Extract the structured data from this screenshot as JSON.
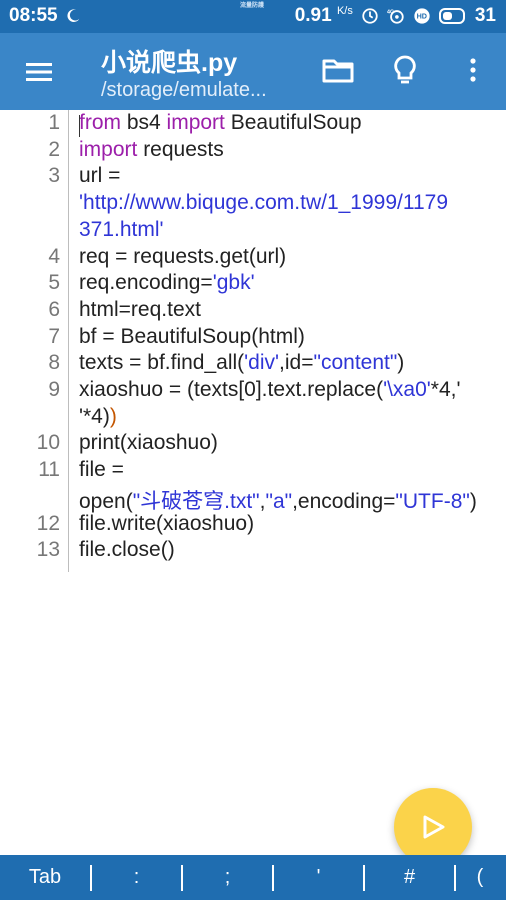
{
  "status_bar": {
    "time": "08:55",
    "center_text": "流量防護",
    "net_speed": "0.91",
    "net_unit": "K/s",
    "battery": "31"
  },
  "app_bar": {
    "title": "小说爬虫.py",
    "subtitle": "/storage/emulate...",
    "icons": [
      "menu-icon",
      "folder-icon",
      "lightbulb-icon",
      "more-vertical-icon"
    ]
  },
  "editor": {
    "lines": [
      {
        "num": "1",
        "segs": [
          {
            "t": "from",
            "c": "kw"
          },
          {
            "t": " bs4 ",
            "c": "cm"
          },
          {
            "t": "import",
            "c": "kw"
          },
          {
            "t": " BeautifulSoup",
            "c": "cm"
          }
        ]
      },
      {
        "num": "2",
        "segs": [
          {
            "t": "import",
            "c": "kw"
          },
          {
            "t": " requests",
            "c": "cm"
          }
        ]
      },
      {
        "num": "3",
        "segs": [
          {
            "t": "url =",
            "c": "cm"
          }
        ]
      },
      {
        "num": "",
        "segs": [
          {
            "t": "'http://www.biquge.com.tw/1_1999/1179",
            "c": "str"
          }
        ]
      },
      {
        "num": "",
        "segs": [
          {
            "t": "371.html'",
            "c": "str"
          }
        ]
      },
      {
        "num": "4",
        "segs": [
          {
            "t": "req = requests.get(url)",
            "c": "cm"
          }
        ]
      },
      {
        "num": "5",
        "segs": [
          {
            "t": "req.encoding=",
            "c": "cm"
          },
          {
            "t": "'gbk'",
            "c": "str"
          }
        ]
      },
      {
        "num": "6",
        "segs": [
          {
            "t": "html=req.text",
            "c": "cm"
          }
        ]
      },
      {
        "num": "7",
        "segs": [
          {
            "t": "bf = BeautifulSoup(html)",
            "c": "cm"
          }
        ]
      },
      {
        "num": "8",
        "segs": [
          {
            "t": "texts = bf.find_all(",
            "c": "cm"
          },
          {
            "t": "'div'",
            "c": "str"
          },
          {
            "t": ",id=",
            "c": "cm"
          },
          {
            "t": "\"content\"",
            "c": "dq"
          },
          {
            "t": ")",
            "c": "cm"
          }
        ]
      },
      {
        "num": "9",
        "segs": [
          {
            "t": "xiaoshuo = (texts[0].text.replace(",
            "c": "cm"
          },
          {
            "t": "'\\xa0'",
            "c": "str"
          },
          {
            "t": "*4,'",
            "c": "cm"
          }
        ]
      },
      {
        "num": "",
        "segs": [
          {
            "t": "'*4)",
            "c": "cm"
          },
          {
            "t": ")",
            "c": "par"
          }
        ]
      },
      {
        "num": "10",
        "segs": [
          {
            "t": "print(xiaoshuo)",
            "c": "cm"
          }
        ]
      },
      {
        "num": "11",
        "segs": [
          {
            "t": "file =",
            "c": "cm"
          }
        ]
      },
      {
        "num": "",
        "segs": [
          {
            "t": "open(",
            "c": "cm"
          },
          {
            "t": "\"斗破苍穹.txt\"",
            "c": "dq"
          },
          {
            "t": ",",
            "c": "cm"
          },
          {
            "t": "\"a\"",
            "c": "dq"
          },
          {
            "t": ",encoding=",
            "c": "cm"
          },
          {
            "t": "\"UTF-8\"",
            "c": "dq"
          },
          {
            "t": ")",
            "c": "cm"
          }
        ]
      },
      {
        "num": "12",
        "segs": [
          {
            "t": "file.write(xiaoshuo)",
            "c": "cm"
          }
        ]
      },
      {
        "num": "13",
        "segs": [
          {
            "t": "file.close()",
            "c": "cm"
          }
        ]
      }
    ]
  },
  "run_button": {
    "icon": "play-icon",
    "color": "#fbd34a"
  },
  "key_bar": {
    "keys": [
      "Tab",
      ":",
      ";",
      "'",
      "#",
      "("
    ]
  },
  "colors": {
    "status_bar": "#1f6db0",
    "app_bar": "#3a86c8",
    "keyword": "#9c1faa",
    "string": "#2f35d6"
  }
}
